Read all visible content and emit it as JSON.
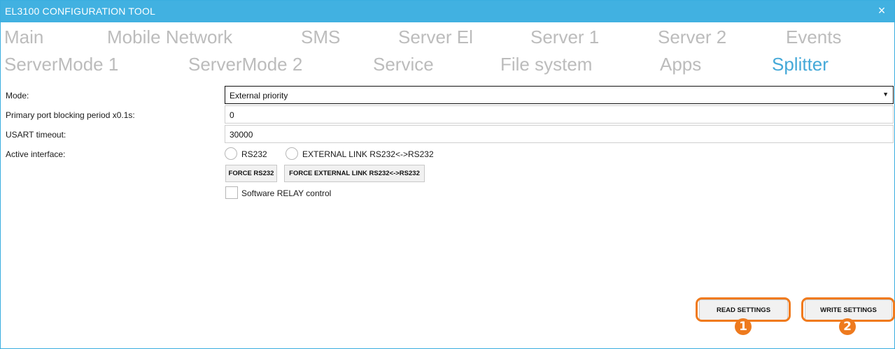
{
  "window": {
    "title": "EL3100 CONFIGURATION TOOL",
    "close_glyph": "×"
  },
  "tabs": [
    {
      "label": "Main"
    },
    {
      "label": "Mobile Network"
    },
    {
      "label": "SMS"
    },
    {
      "label": "Server El"
    },
    {
      "label": "Server 1"
    },
    {
      "label": "Server 2"
    },
    {
      "label": "Events"
    },
    {
      "label": "ServerMode 1"
    },
    {
      "label": "ServerMode 2"
    },
    {
      "label": "Service"
    },
    {
      "label": "File system"
    },
    {
      "label": "Apps"
    },
    {
      "label": "Splitter",
      "active": true
    }
  ],
  "form": {
    "mode": {
      "label": "Mode:",
      "value": "External priority",
      "caret": "▼"
    },
    "blocking": {
      "label": "Primary port blocking period x0.1s:",
      "value": "0"
    },
    "usart": {
      "label": "USART timeout:",
      "value": "30000"
    },
    "interface": {
      "label": "Active interface:",
      "options": [
        {
          "label": "RS232",
          "selected": false
        },
        {
          "label": "EXTERNAL LINK RS232<->RS232",
          "selected": false
        }
      ],
      "force_rs232": "FORCE RS232",
      "force_external": "FORCE EXTERNAL LINK RS232<->RS232"
    },
    "relay": {
      "label": "Software RELAY control",
      "checked": false
    }
  },
  "actions": {
    "read": {
      "label": "READ SETTINGS",
      "badge": "1"
    },
    "write": {
      "label": "WRITE SETTINGS",
      "badge": "2"
    }
  },
  "colors": {
    "titlebar": "#41b1e1",
    "active_tab": "#45a9d8",
    "inactive_tab": "#bcbcbc",
    "highlight": "#f07a1c"
  }
}
